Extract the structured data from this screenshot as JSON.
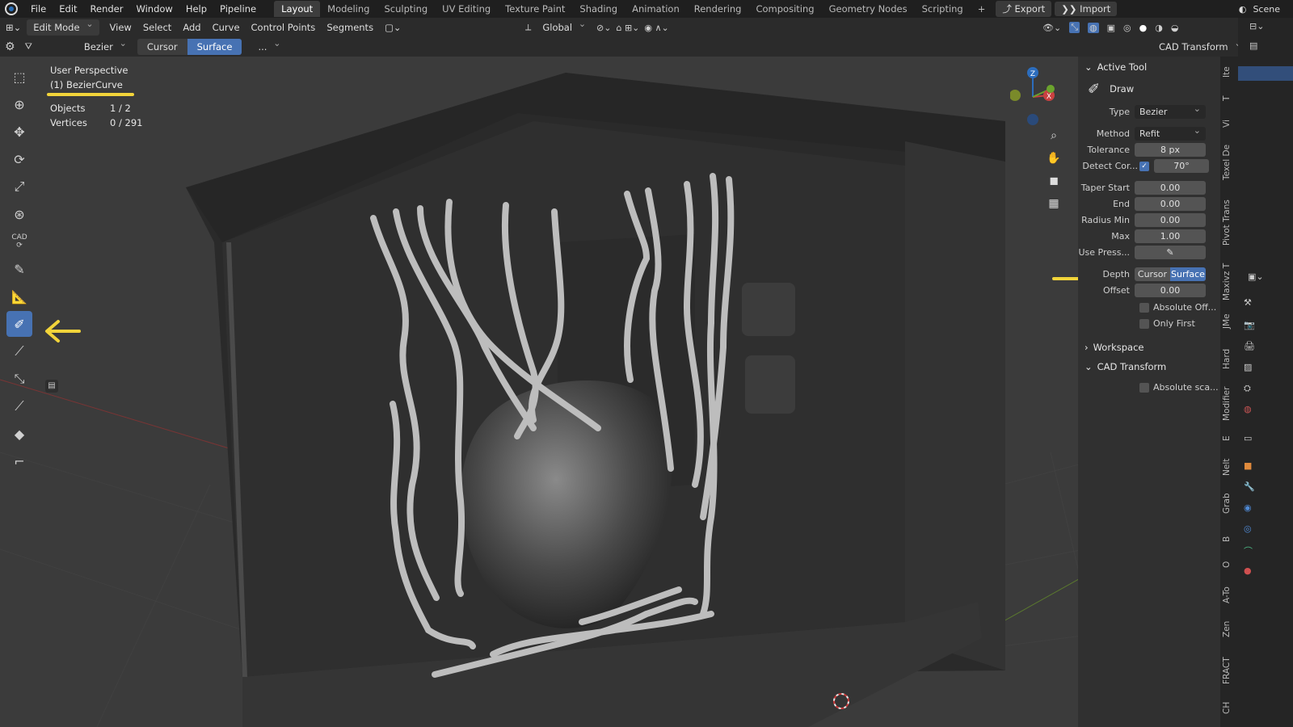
{
  "menubar": {
    "items": [
      "File",
      "Edit",
      "Render",
      "Window",
      "Help",
      "Pipeline"
    ],
    "workspaces": [
      "Layout",
      "Modeling",
      "Sculpting",
      "UV Editing",
      "Texture Paint",
      "Shading",
      "Animation",
      "Rendering",
      "Compositing",
      "Geometry Nodes",
      "Scripting"
    ],
    "active_workspace": "Layout",
    "export_label": "Export",
    "import_label": "Import",
    "scene_label": "Scene"
  },
  "header": {
    "mode": "Edit Mode",
    "menus": [
      "View",
      "Select",
      "Add",
      "Curve",
      "Control Points",
      "Segments"
    ],
    "transform_orientation": "Global"
  },
  "tool_header": {
    "type": "Bezier",
    "depth_options": [
      "Cursor",
      "Surface"
    ],
    "active_depth": "Surface",
    "more": "...",
    "cad_transform": "CAD Transform"
  },
  "viewport_info": {
    "perspective": "User Perspective",
    "object": "(1) BezierCurve",
    "objects_label": "Objects",
    "objects_value": "1 / 2",
    "vertices_label": "Vertices",
    "vertices_value": "0 / 291"
  },
  "gizmo": {
    "z": "Z",
    "x": "X"
  },
  "toolbar_icons": [
    "select-box-icon",
    "cursor-icon",
    "move-icon",
    "rotate-icon",
    "scale-icon",
    "transform-icon",
    "cad-icon",
    "annotate-icon",
    "measure-icon",
    "draw-curve-icon",
    "pen-icon",
    "tilt-icon",
    "radius-icon",
    "extrude-icon",
    "randomize-icon"
  ],
  "toolbar_cad_label": "CAD",
  "panel": {
    "active_tool_title": "Active Tool",
    "tool_name": "Draw",
    "type_label": "Type",
    "type_value": "Bezier",
    "method_label": "Method",
    "method_value": "Refit",
    "tolerance_label": "Tolerance",
    "tolerance_value": "8 px",
    "detect_corners_label": "Detect Cor...",
    "detect_corners_value": "70°",
    "taper_start_label": "Taper Start",
    "taper_start_value": "0.00",
    "taper_end_label": "End",
    "taper_end_value": "0.00",
    "radius_min_label": "Radius Min",
    "radius_min_value": "0.00",
    "radius_max_label": "Max",
    "radius_max_value": "1.00",
    "use_pressure_label": "Use Press...",
    "depth_label": "Depth",
    "depth_cursor": "Cursor",
    "depth_surface": "Surface",
    "offset_label": "Offset",
    "offset_value": "0.00",
    "absolute_offset_label": "Absolute Off...",
    "only_first_label": "Only First",
    "workspace_title": "Workspace",
    "cad_transform_title": "CAD Transform",
    "absolute_scale_label": "Absolute sca..."
  },
  "side_tabs": [
    "Ite",
    "T",
    "Vi",
    "Texel De",
    "Pivot Trans",
    "Maxivz T",
    "JMe",
    "Hard",
    "Modifier",
    "E",
    "Nelt",
    "Grab",
    "B",
    "O",
    "A-To",
    "Zen",
    "FRACT",
    "CH"
  ],
  "colors": {
    "accent": "#4772b3",
    "annotation": "#f2d43a"
  }
}
